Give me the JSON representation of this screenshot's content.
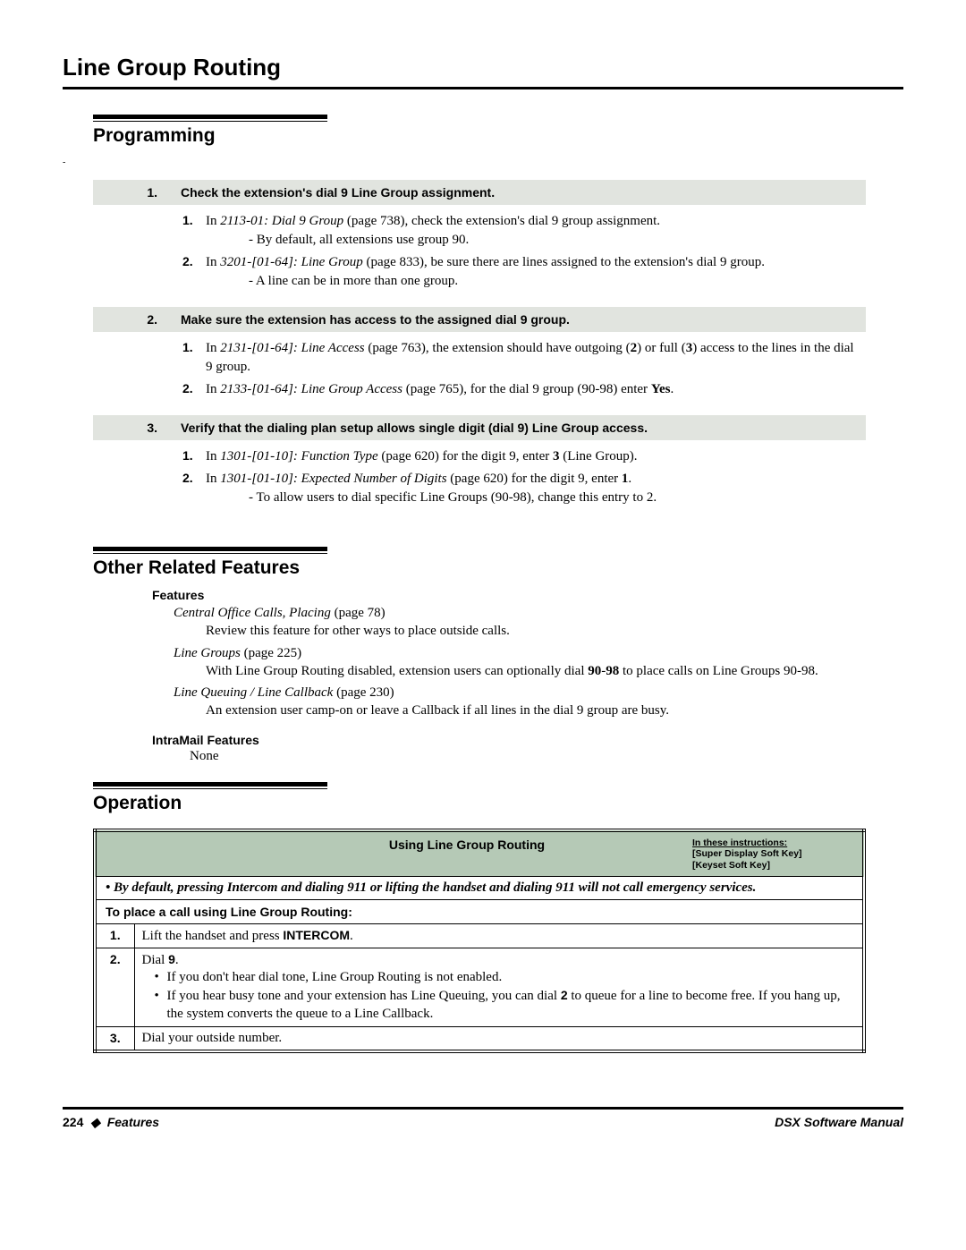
{
  "page_title": "Line Group Routing",
  "sections": {
    "programming": {
      "heading": "Programming",
      "rows": [
        {
          "num": "1.",
          "title": "Check the extension's dial 9 Line Group assignment.",
          "items": [
            {
              "n": "1.",
              "pre": "In ",
              "ital": "2113-01: Dial 9 Group",
              "post": " (page 738), check the extension's dial 9 group assignment.",
              "dash": "By default, all extensions use group 90."
            },
            {
              "n": "2.",
              "pre": "In ",
              "ital": "3201-[01-64]: Line Group",
              "post": " (page 833), be sure there are lines assigned to the extension's dial 9 group.",
              "dash": "A line can be in more than one group."
            }
          ]
        },
        {
          "num": "2.",
          "title": "Make sure the extension has access to the assigned dial 9 group.",
          "items": [
            {
              "n": "1.",
              "pre": "In ",
              "ital": "2131-[01-64]: Line Access",
              "post": " (page 763), the extension should have outgoing (",
              "bold1": "2",
              "post2": ") or full (",
              "bold2": "3",
              "post3": ") access to the lines in the dial 9 group."
            },
            {
              "n": "2.",
              "pre": "In ",
              "ital": "2133-[01-64]: Line Group Access",
              "post": " (page 765), for the dial 9 group (90-98) enter ",
              "bold1": "Yes",
              "post2": "."
            }
          ]
        },
        {
          "num": "3.",
          "title": "Verify that the dialing plan setup allows single digit (dial 9) Line Group access.",
          "items": [
            {
              "n": "1.",
              "pre": "In ",
              "ital": "1301-[01-10]: Function Type",
              "post": " (page 620) for the digit 9, enter ",
              "bold1": "3",
              "post2": " (Line Group)."
            },
            {
              "n": "2.",
              "pre": "In ",
              "ital": "1301-[01-10]: Expected Number of Digits",
              "post": " (page 620) for the digit 9, enter ",
              "bold1": "1",
              "post2": ".",
              "dash": "To allow users to dial specific Line Groups (90-98), change this entry to 2."
            }
          ]
        }
      ]
    },
    "related": {
      "heading": "Other Related Features",
      "features_label": "Features",
      "features": [
        {
          "title": "Central Office Calls, Placing",
          "page": " (page 78)",
          "desc": "Review this feature for other ways to place outside calls."
        },
        {
          "title": "Line Groups",
          "page": " (page 225)",
          "desc_pre": "With Line Group Routing disabled, extension users can optionally dial ",
          "bold1": "90",
          "mid": "-",
          "bold2": "98",
          "desc_post": " to place calls on Line Groups 90-98."
        },
        {
          "title": "Line Queuing / Line Callback",
          "page": " (page 230)",
          "desc": "An extension user camp-on or leave a Callback if all lines in the dial 9 group are busy."
        }
      ],
      "intramail_label": "IntraMail Features",
      "intramail_value": "None"
    },
    "operation": {
      "heading": "Operation",
      "table_title": "Using Line Group Routing",
      "notes_l1": "In these instructions:",
      "notes_l2": "[Super Display Soft Key]",
      "notes_l3": "[Keyset Soft Key]",
      "warning": "By default, pressing Intercom and dialing 911 or lifting the handset and dialing 911 will not call emergency services.",
      "sub_head": "To place a call using Line Group Routing:",
      "steps": [
        {
          "n": "1.",
          "text_pre": "Lift the handset and press ",
          "bold": "INTERCOM",
          "text_post": "."
        },
        {
          "n": "2.",
          "text_pre": "Dial ",
          "bold": "9",
          "text_post": ".",
          "bullets": [
            "If you don't hear dial tone, Line Group Routing is not enabled.",
            {
              "pre": "If you hear busy tone and your extension has Line Queuing, you can dial ",
              "bold": "2",
              "post": " to queue for a line to become free. If you hang up, the system converts the queue to a Line Callback."
            }
          ]
        },
        {
          "n": "3.",
          "text_pre": "Dial your outside number."
        }
      ]
    }
  },
  "footer": {
    "page_num": "224",
    "diamond": "◆",
    "section": "Features",
    "manual": "DSX Software Manual"
  }
}
